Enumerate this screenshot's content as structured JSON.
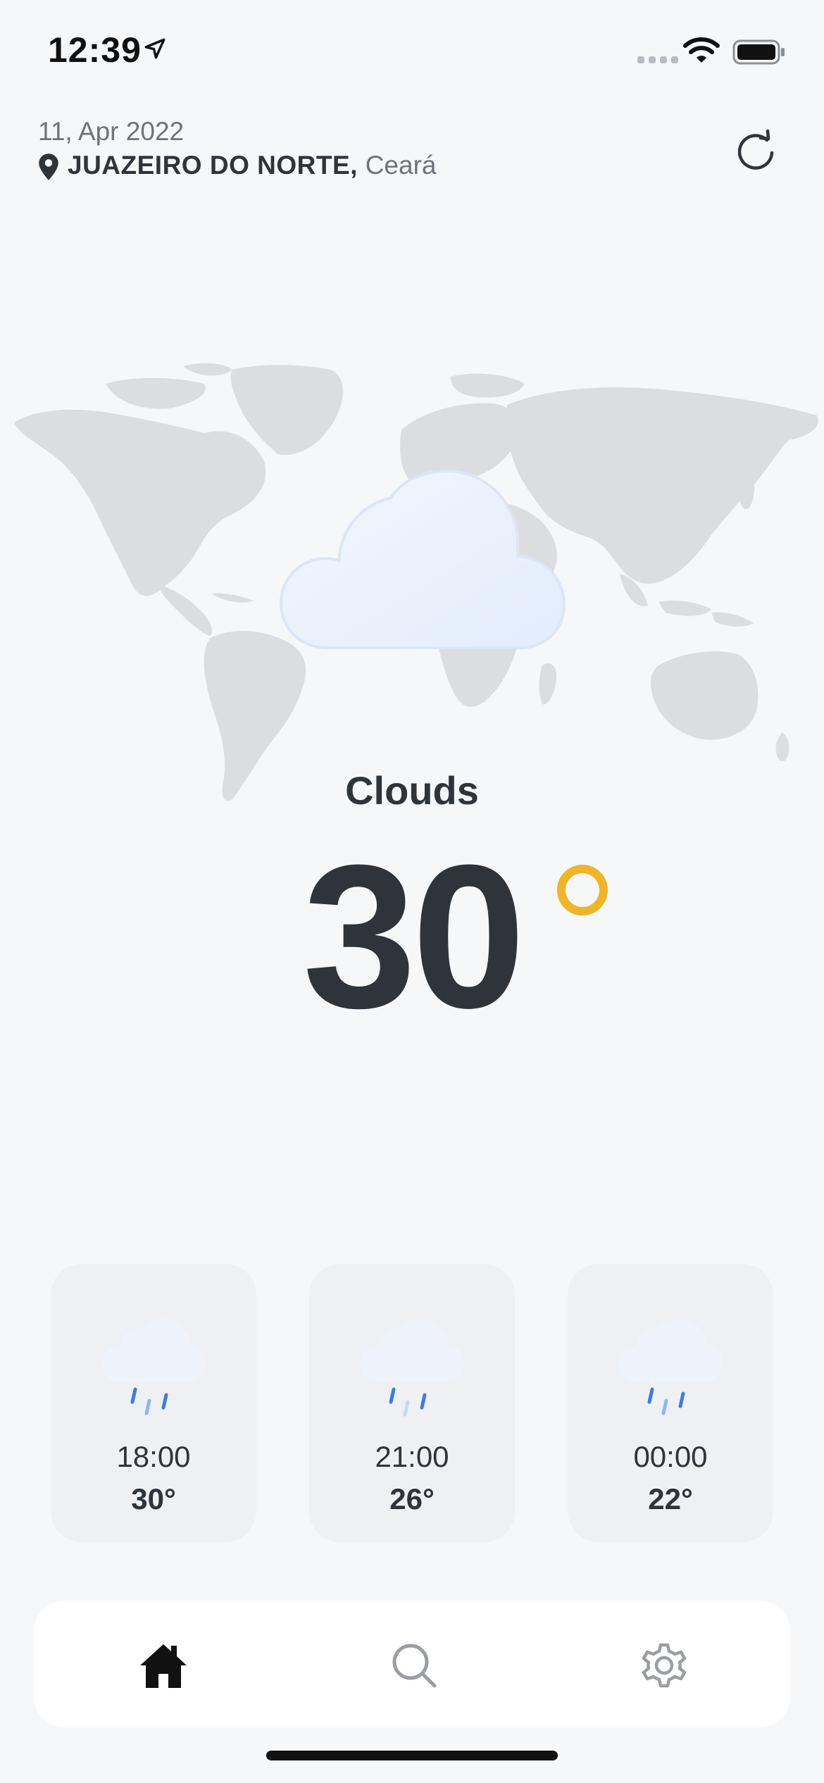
{
  "status_bar": {
    "time": "12:39"
  },
  "header": {
    "date": "11, Apr 2022",
    "city": "JUAZEIRO DO NORTE,",
    "state": "Ceará"
  },
  "current": {
    "condition": "Clouds",
    "temperature": "30"
  },
  "forecast": [
    {
      "time": "18:00",
      "temp": "30°",
      "icon": "rain-cloud-icon"
    },
    {
      "time": "21:00",
      "temp": "26°",
      "icon": "rain-cloud-icon"
    },
    {
      "time": "00:00",
      "temp": "22°",
      "icon": "rain-cloud-icon"
    }
  ],
  "tabs": [
    {
      "name": "home",
      "icon": "home-icon",
      "active": true
    },
    {
      "name": "search",
      "icon": "search-icon",
      "active": false
    },
    {
      "name": "settings",
      "icon": "gear-icon",
      "active": false
    }
  ],
  "colors": {
    "accent_degree": "#f0b429",
    "text": "#2f343b",
    "background": "#f6f7f9"
  }
}
